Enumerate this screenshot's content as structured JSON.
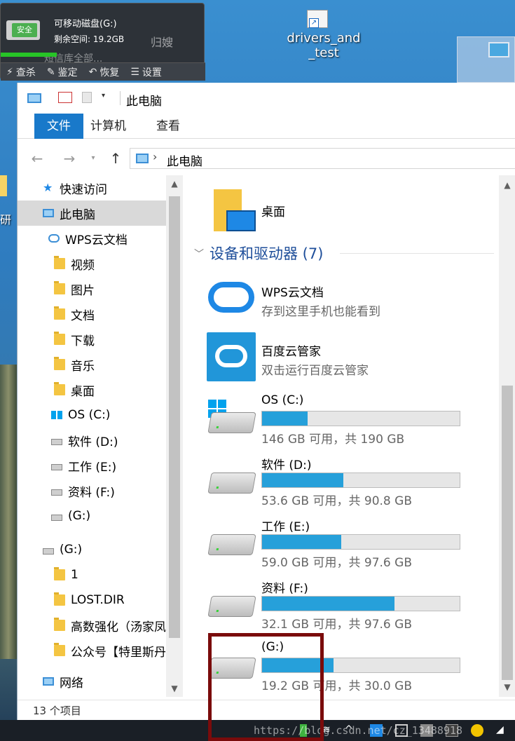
{
  "desktop": {
    "shortcut_label": "drivers_and_test",
    "shortcut_line1": "drivers_and",
    "shortcut_line2": "_test",
    "left_fragment": "研"
  },
  "usb_popup": {
    "safe_badge": "安全",
    "title": "可移动磁盘(G:)",
    "free_space": "剩余空间: 19.2GB",
    "ghost_text_1": "归嫂",
    "ghost_text_2": "短信库全部...",
    "actions": [
      "查杀",
      "鉴定",
      "恢复",
      "设置"
    ]
  },
  "explorer": {
    "title": "此电脑",
    "ribbon_tabs": [
      "文件",
      "计算机",
      "查看"
    ],
    "address": "此电脑",
    "nav_items": [
      {
        "label": "快速访问",
        "icon": "star-icon"
      },
      {
        "label": "此电脑",
        "icon": "pc-icon",
        "selected": true
      },
      {
        "label": "WPS云文档",
        "icon": "cloud-icon"
      },
      {
        "label": "视频",
        "icon": "video-folder-icon"
      },
      {
        "label": "图片",
        "icon": "pictures-folder-icon"
      },
      {
        "label": "文档",
        "icon": "documents-folder-icon"
      },
      {
        "label": "下载",
        "icon": "downloads-folder-icon"
      },
      {
        "label": "音乐",
        "icon": "music-folder-icon"
      },
      {
        "label": "桌面",
        "icon": "desktop-folder-icon"
      },
      {
        "label": "OS (C:)",
        "icon": "windows-drive-icon"
      },
      {
        "label": "软件 (D:)",
        "icon": "drive-icon"
      },
      {
        "label": "工作 (E:)",
        "icon": "drive-icon"
      },
      {
        "label": "资料 (F:)",
        "icon": "drive-icon"
      },
      {
        "label": " (G:)",
        "icon": "drive-icon"
      },
      {
        "label": " (G:)",
        "icon": "usb-drive-icon"
      },
      {
        "label": "1",
        "icon": "folder-icon"
      },
      {
        "label": "LOST.DIR",
        "icon": "folder-icon"
      },
      {
        "label": "高数强化（汤家凤",
        "icon": "folder-icon"
      },
      {
        "label": "公众号【特里斯丹",
        "icon": "folder-icon"
      },
      {
        "label": "网络",
        "icon": "network-icon"
      }
    ],
    "content": {
      "desktop_item": "桌面",
      "group_title": "设备和驱动器 (7)",
      "apps": [
        {
          "name": "WPS云文档",
          "sub": "存到这里手机也能看到",
          "icon": "wps-cloud-icon"
        },
        {
          "name": "百度云管家",
          "sub": "双击运行百度云管家",
          "icon": "baidu-cloud-icon"
        }
      ],
      "drives": [
        {
          "name": "OS (C:)",
          "space": "146 GB 可用，共 190 GB",
          "used_fraction": 0.23,
          "icon": "windows-drive-icon"
        },
        {
          "name": "软件 (D:)",
          "space": "53.6 GB 可用，共 90.8 GB",
          "used_fraction": 0.41,
          "icon": "drive-icon"
        },
        {
          "name": "工作 (E:)",
          "space": "59.0 GB 可用，共 97.6 GB",
          "used_fraction": 0.4,
          "icon": "drive-icon"
        },
        {
          "name": "资料 (F:)",
          "space": "32.1 GB 可用，共 97.6 GB",
          "used_fraction": 0.67,
          "icon": "drive-icon"
        },
        {
          "name": " (G:)",
          "space": "19.2 GB 可用，共 30.0 GB",
          "used_fraction": 0.36,
          "icon": "usb-drive-icon"
        }
      ]
    },
    "status": "13 个项目"
  },
  "taskbar": {
    "watermark": "https://blog.csdn.net/cz_13488918"
  },
  "colors": {
    "accent": "#1979ca",
    "drive_fill": "#26a0da",
    "group_title": "#1e4e9a",
    "highlight_box": "#7a0b0b"
  }
}
